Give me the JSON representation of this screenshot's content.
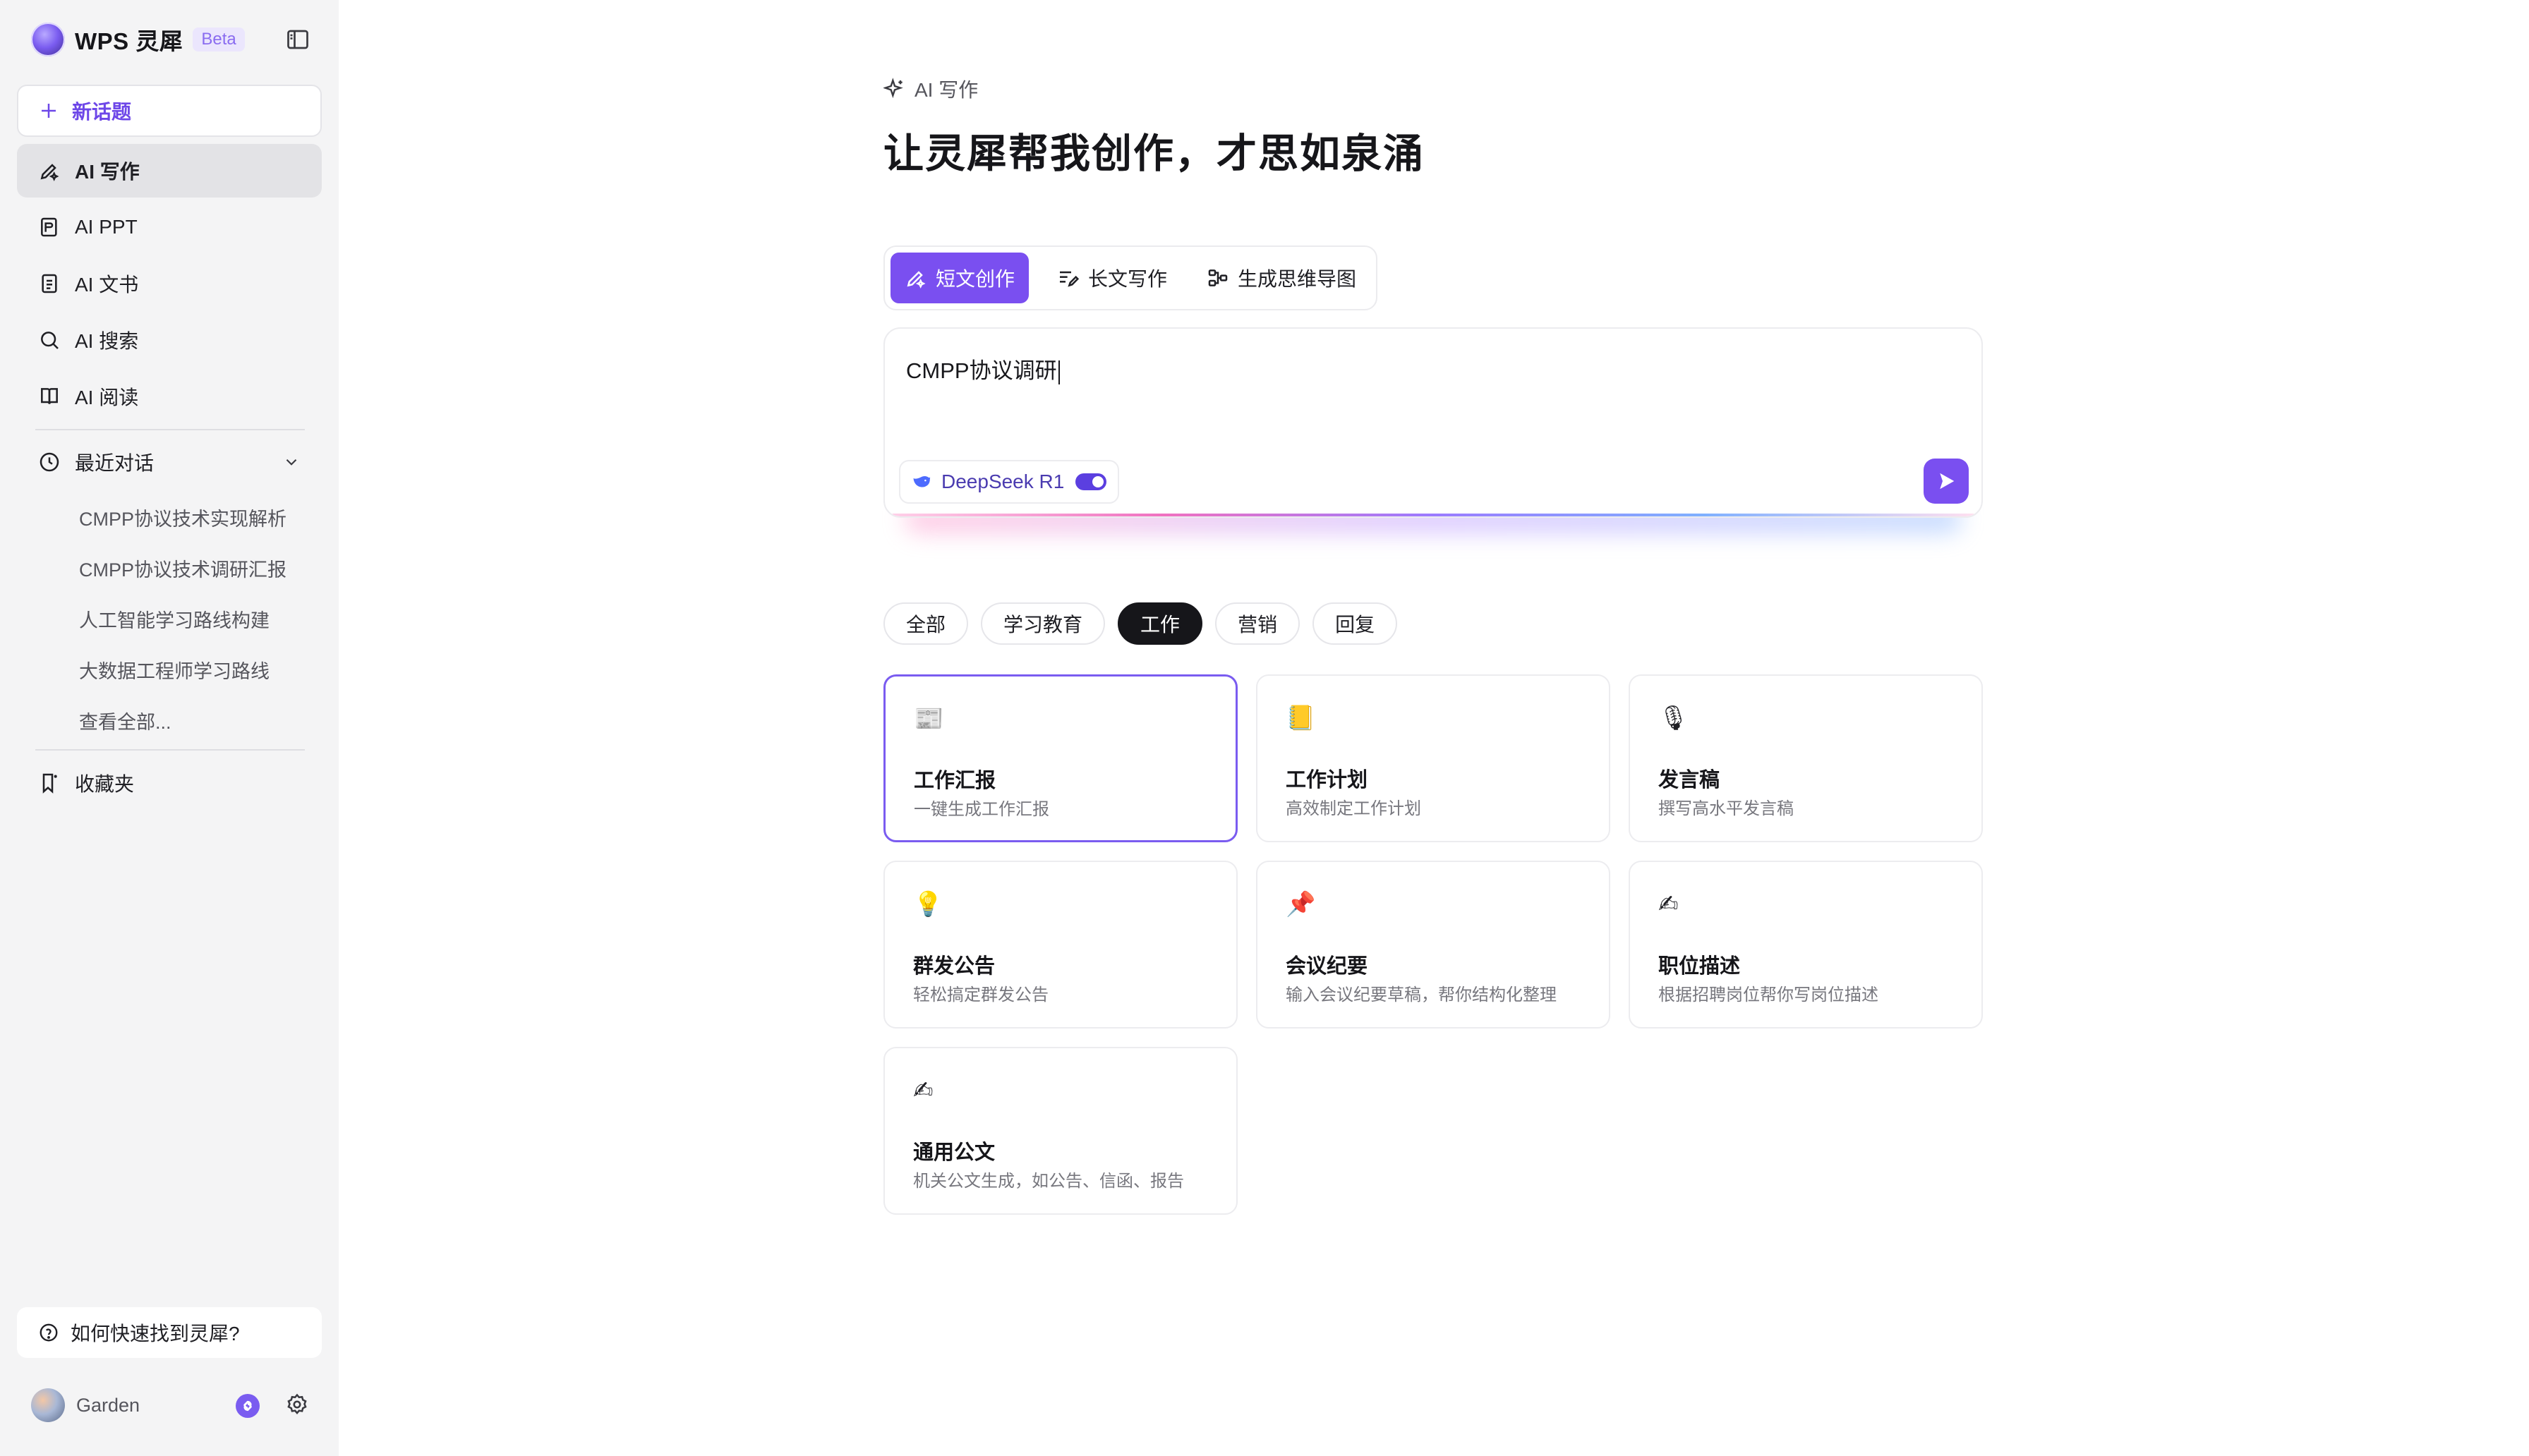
{
  "sidebar": {
    "brand": "WPS 灵犀",
    "beta": "Beta",
    "new_topic": "新话题",
    "nav": [
      {
        "label": "AI 写作",
        "icon": "pen-sparkle-icon"
      },
      {
        "label": "AI PPT",
        "icon": "ppt-icon"
      },
      {
        "label": "AI 文书",
        "icon": "document-icon"
      },
      {
        "label": "AI 搜索",
        "icon": "search-icon"
      },
      {
        "label": "AI 阅读",
        "icon": "book-icon"
      }
    ],
    "recent_title": "最近对话",
    "recent": [
      "CMPP协议技术实现解析",
      "CMPP协议技术调研汇报",
      "人工智能学习路线构建",
      "大数据工程师学习路线",
      "查看全部..."
    ],
    "favorites": "收藏夹",
    "help": "如何快速找到灵犀?",
    "user": "Garden"
  },
  "main": {
    "section_label": "AI 写作",
    "headline": "让灵犀帮我创作，才思如泉涌",
    "mode_tabs": [
      {
        "label": "短文创作",
        "icon": "pen-sparkle-icon"
      },
      {
        "label": "长文写作",
        "icon": "long-text-icon"
      },
      {
        "label": "生成思维导图",
        "icon": "mind-map-icon"
      }
    ],
    "input_value": "CMPP协议调研",
    "model": "DeepSeek R1",
    "categories": [
      "全部",
      "学习教育",
      "工作",
      "营销",
      "回复"
    ],
    "active_category": "工作",
    "cards": [
      {
        "icon": "📰",
        "title": "工作汇报",
        "desc": "一键生成工作汇报"
      },
      {
        "icon": "📒",
        "title": "工作计划",
        "desc": "高效制定工作计划"
      },
      {
        "icon": "🎙",
        "title": "发言稿",
        "desc": "撰写高水平发言稿"
      },
      {
        "icon": "💡",
        "title": "群发公告",
        "desc": "轻松搞定群发公告"
      },
      {
        "icon": "📌",
        "title": "会议纪要",
        "desc": "输入会议纪要草稿，帮你结构化整理"
      },
      {
        "icon": "✍",
        "title": "职位描述",
        "desc": "根据招聘岗位帮你写岗位描述"
      },
      {
        "icon": "✍",
        "title": "通用公文",
        "desc": "机关公文生成，如公告、信函、报告"
      }
    ]
  },
  "colors": {
    "accent": "#7a4ff0",
    "sidebar_bg": "#f4f4f5",
    "active_chip": "#16161a"
  }
}
